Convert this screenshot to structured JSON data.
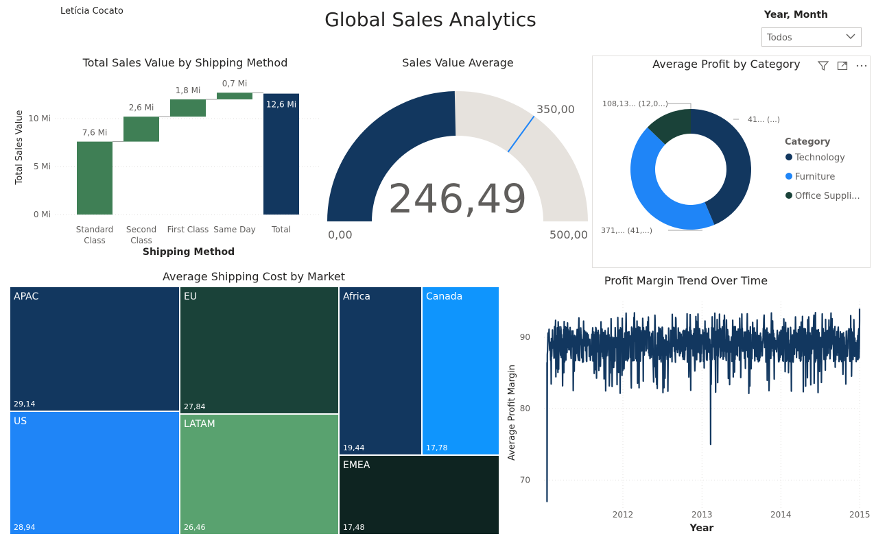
{
  "author": "Letícia Cocato",
  "title": "Global Sales Analytics",
  "slicer": {
    "label": "Year, Month",
    "value": "Todos"
  },
  "waterfall": {
    "title": "Total Sales Value by Shipping Method",
    "xlabel": "Shipping Method",
    "ylabel": "Total Sales Value",
    "ticks": [
      "0 Mi",
      "5 Mi",
      "10 Mi"
    ],
    "categories": [
      "Standard Class",
      "Second Class",
      "First Class",
      "Same Day",
      "Total"
    ],
    "category_lines": [
      [
        "Standard",
        "Class"
      ],
      [
        "Second",
        "Class"
      ],
      [
        "First Class"
      ],
      [
        "Same Day"
      ],
      [
        "Total"
      ]
    ],
    "labels": [
      "7,6 Mi",
      "2,6 Mi",
      "1,8 Mi",
      "0,7 Mi",
      "12,6 Mi"
    ]
  },
  "gauge": {
    "title": "Sales Value Average",
    "value_label": "246,49",
    "min_label": "0,00",
    "max_label": "500,00",
    "target_label": "350,00"
  },
  "donut": {
    "title": "Average Profit by Category",
    "legend_title": "Category",
    "legend": [
      "Technology",
      "Furniture",
      "Office Suppli..."
    ],
    "labels": [
      "41... (...)",
      "371,... (41,...)",
      "108,13... (12,0...)"
    ],
    "colors": [
      "#12375f",
      "#1f85f7",
      "#1a4239"
    ]
  },
  "treemap": {
    "title": "Average Shipping Cost by Market",
    "names": [
      "APAC",
      "US",
      "EU",
      "LATAM",
      "Africa",
      "EMEA",
      "Canada"
    ],
    "labels": [
      "29,14",
      "28,94",
      "27,84",
      "26,46",
      "19,44",
      "17,48",
      "17,78"
    ],
    "colors": [
      "#12375f",
      "#1f85f7",
      "#1a4239",
      "#59a26f",
      "#12375f",
      "#0e2421",
      "#0f95fd"
    ]
  },
  "trend": {
    "title": "Profit Margin Trend Over Time",
    "xlabel": "Year",
    "ylabel": "Average Profit Margin",
    "xticks": [
      "2012",
      "2013",
      "2014",
      "2015"
    ],
    "yticks": [
      "70",
      "80",
      "90"
    ],
    "color": "#12375f"
  },
  "chart_data": [
    {
      "type": "bar",
      "subtype": "waterfall",
      "title": "Total Sales Value by Shipping Method",
      "xlabel": "Shipping Method",
      "ylabel": "Total Sales Value",
      "categories": [
        "Standard Class",
        "Second Class",
        "First Class",
        "Same Day",
        "Total"
      ],
      "values": [
        7.6,
        2.6,
        1.8,
        0.7,
        12.6
      ],
      "unit": "Mi",
      "ylim": [
        0,
        13
      ],
      "grid": true,
      "colors": {
        "increase": "#3f7f55",
        "total": "#12375f"
      }
    },
    {
      "type": "gauge",
      "title": "Sales Value Average",
      "value": 246.49,
      "min": 0,
      "max": 500,
      "target": 350,
      "colors": {
        "fill": "#12375f",
        "track": "#e6e2dd",
        "target": "#1f85f7"
      }
    },
    {
      "type": "pie",
      "subtype": "donut",
      "title": "Average Profit by Category",
      "categories": [
        "Technology",
        "Furniture",
        "Office Supplies"
      ],
      "values": [
        41,
        41,
        12.0
      ],
      "legend_position": "right"
    },
    {
      "type": "treemap",
      "title": "Average Shipping Cost by Market",
      "categories": [
        "APAC",
        "US",
        "EU",
        "LATAM",
        "Africa",
        "EMEA",
        "Canada"
      ],
      "values": [
        29.14,
        28.94,
        27.84,
        26.46,
        19.44,
        17.48,
        17.78
      ]
    },
    {
      "type": "line",
      "title": "Profit Margin Trend Over Time",
      "xlabel": "Year",
      "ylabel": "Average Profit Margin",
      "xlim": [
        "2011-01-01",
        "2014-12-31"
      ],
      "ylim": [
        66,
        95
      ],
      "grid": true,
      "series": [
        {
          "x": [
            "2011-01-15",
            "2011-03-01",
            "2011-05-01",
            "2011-07-01",
            "2011-09-01",
            "2011-11-01",
            "2012-01-01",
            "2012-03-01",
            "2012-05-01",
            "2012-07-01",
            "2012-09-01",
            "2012-11-01",
            "2013-01-01",
            "2013-02-10",
            "2013-03-01",
            "2013-05-01",
            "2013-07-01",
            "2013-09-01",
            "2013-11-01",
            "2014-01-01",
            "2014-03-01",
            "2014-05-01",
            "2014-07-01",
            "2014-09-01",
            "2014-11-01",
            "2014-12-31"
          ],
          "values": [
            67,
            89,
            88,
            88.5,
            89,
            88,
            89,
            88.5,
            89,
            89.5,
            88.5,
            89,
            89,
            75,
            88.5,
            89,
            89.5,
            88.5,
            89,
            89,
            89.5,
            88.5,
            89,
            89,
            89.5,
            94
          ]
        }
      ]
    }
  ]
}
